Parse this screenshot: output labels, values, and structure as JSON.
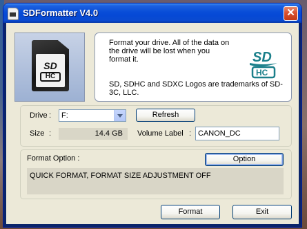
{
  "window": {
    "title": "SDFormatter V4.0",
    "close_glyph": "✕"
  },
  "card_graphic": {
    "logo_text": "SD",
    "hc_text": "HC"
  },
  "info": {
    "line1": "Format your drive. All of the data on the drive will be lost when you format it.",
    "line2": "SD, SDHC and SDXC Logos are trademarks of SD-3C, LLC.",
    "logo_sd": "SD",
    "logo_hc": "HC"
  },
  "drive": {
    "drive_label": "Drive",
    "colon": ":",
    "selected_drive": "F:",
    "refresh_label": "Refresh",
    "size_label": "Size",
    "size_value": "14.4  GB",
    "volume_label_label": "Volume Label",
    "volume_label_value": "CANON_DC"
  },
  "format_option": {
    "label": "Format Option :",
    "option_button": "Option",
    "current_value": "QUICK FORMAT, FORMAT SIZE ADJUSTMENT OFF"
  },
  "actions": {
    "format_button": "Format",
    "exit_button": "Exit"
  },
  "colors": {
    "titlebar_blue": "#0549d6",
    "sdhc_logo_teal": "#1a7f8a"
  }
}
